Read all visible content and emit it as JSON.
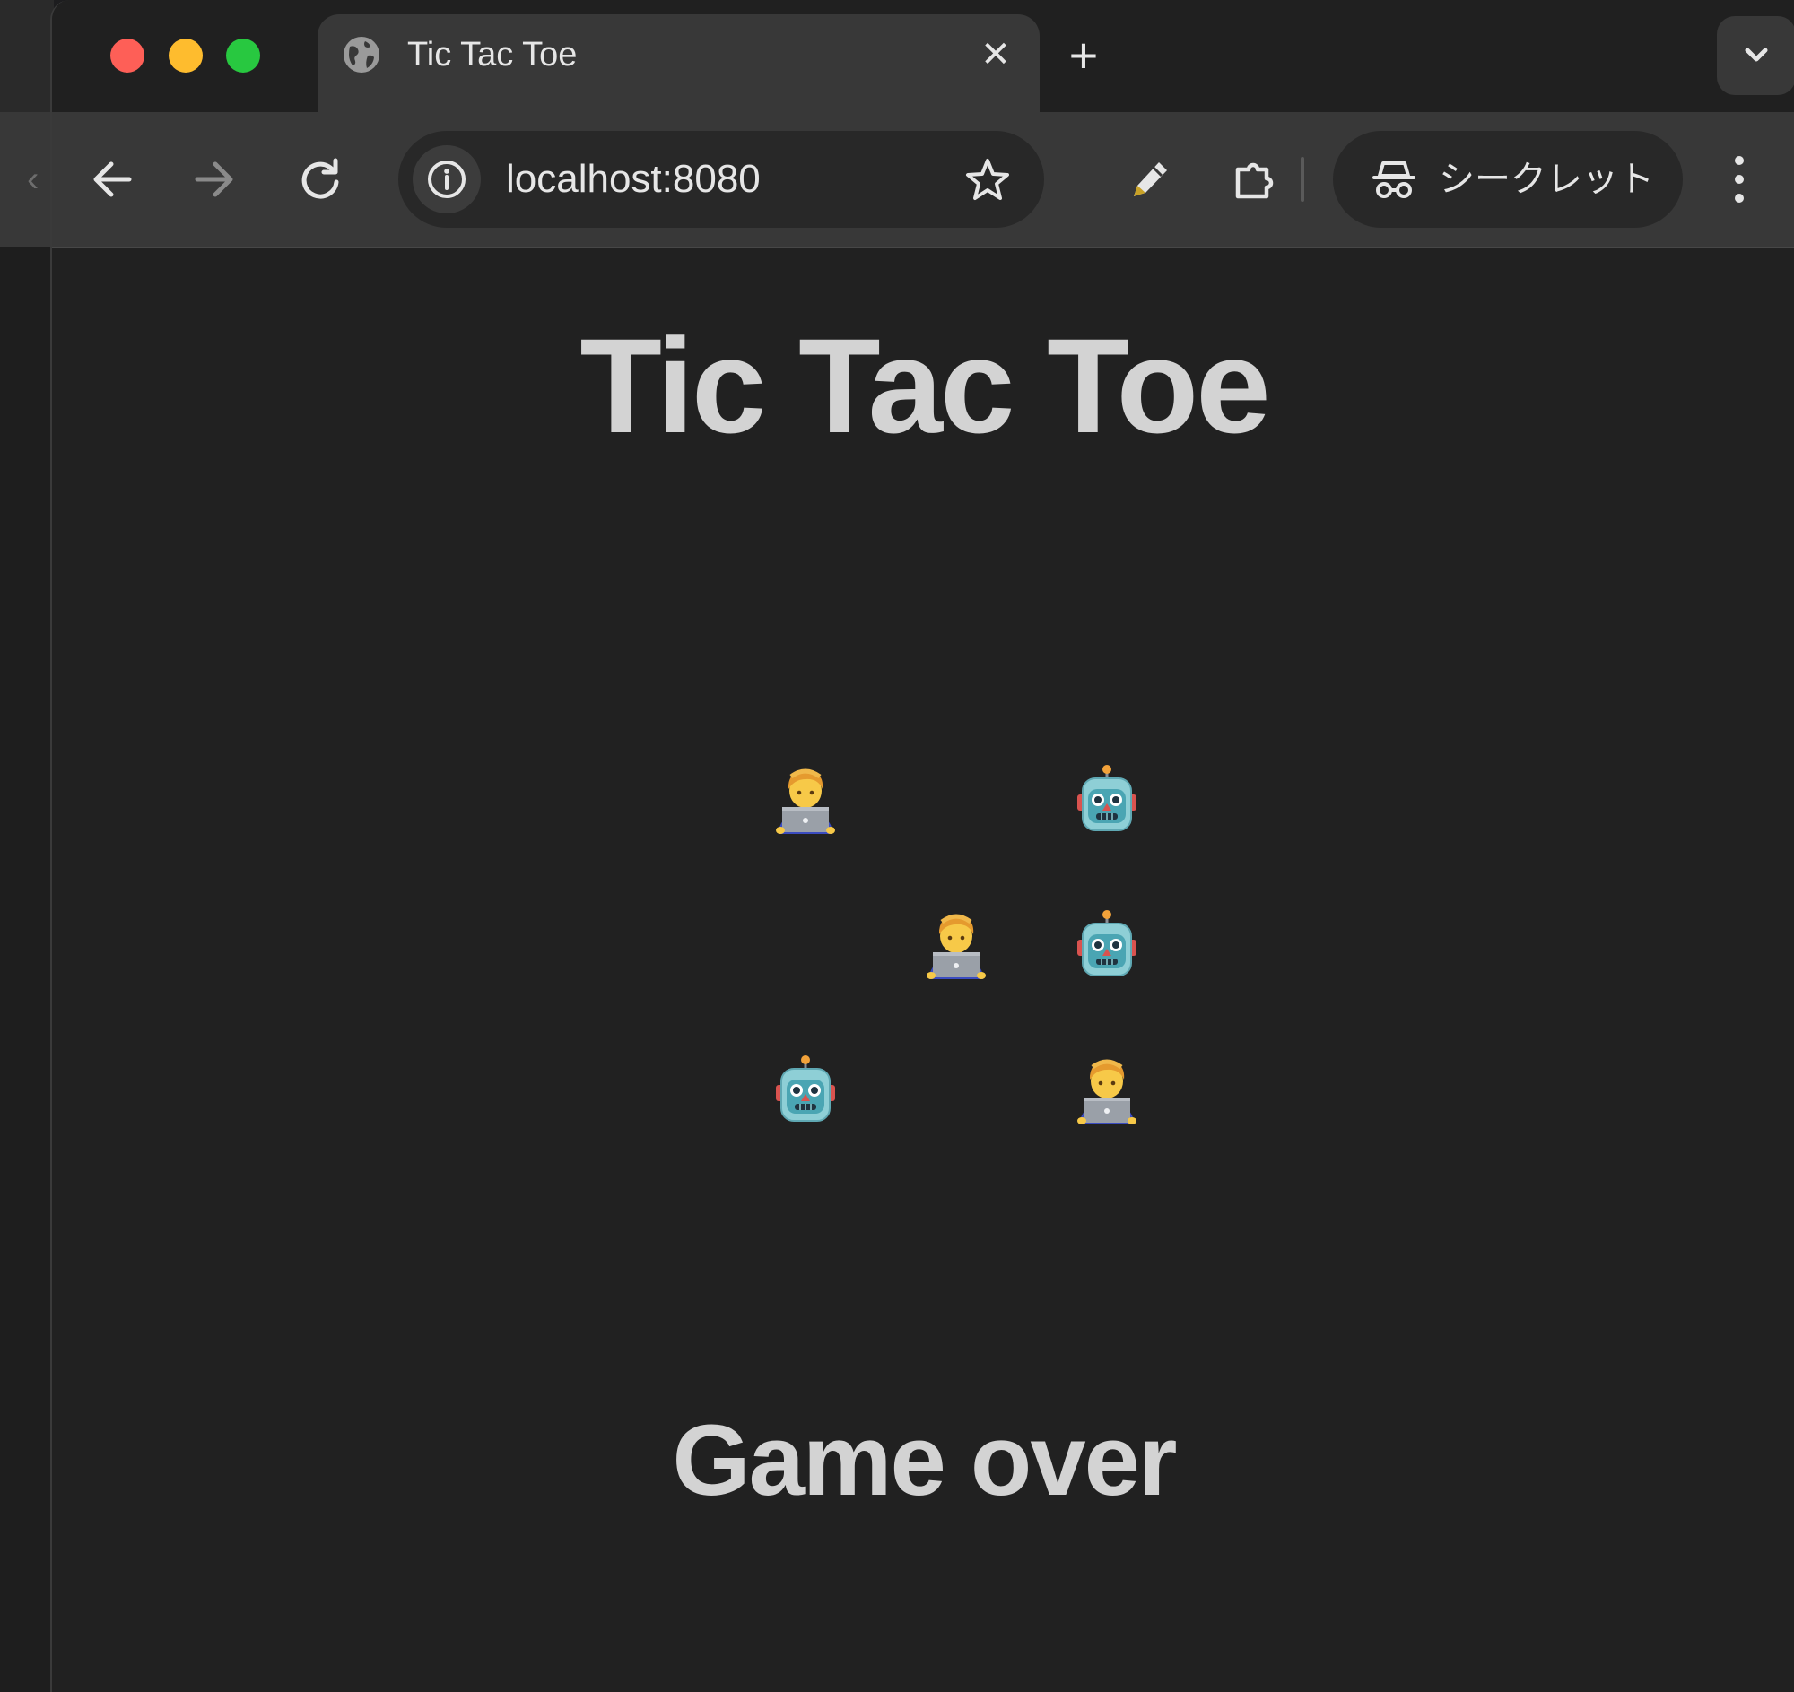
{
  "browser": {
    "tab_title": "Tic Tac Toe",
    "tab_close_glyph": "✕",
    "new_tab_glyph": "+",
    "url": "localhost:8080",
    "incognito_label": "シークレット",
    "icons": [
      "globe-icon",
      "close-icon",
      "plus-icon",
      "chevron-down-icon",
      "back-arrow-icon",
      "forward-arrow-icon",
      "reload-icon",
      "info-icon",
      "star-icon",
      "pen-icon",
      "puzzle-icon",
      "incognito-icon",
      "more-vert-icon"
    ]
  },
  "page": {
    "title": "Tic Tac Toe",
    "status": "Game over"
  },
  "board": {
    "cells": [
      "human",
      "",
      "robot",
      "",
      "human",
      "robot",
      "robot",
      "",
      "human"
    ],
    "pieces": {
      "human": "technologist-emoji",
      "robot": "robot-emoji"
    }
  },
  "colors": {
    "background": "#212121",
    "text": "#d3d3d3",
    "toolbar": "#383838",
    "omnibox": "#282828"
  }
}
